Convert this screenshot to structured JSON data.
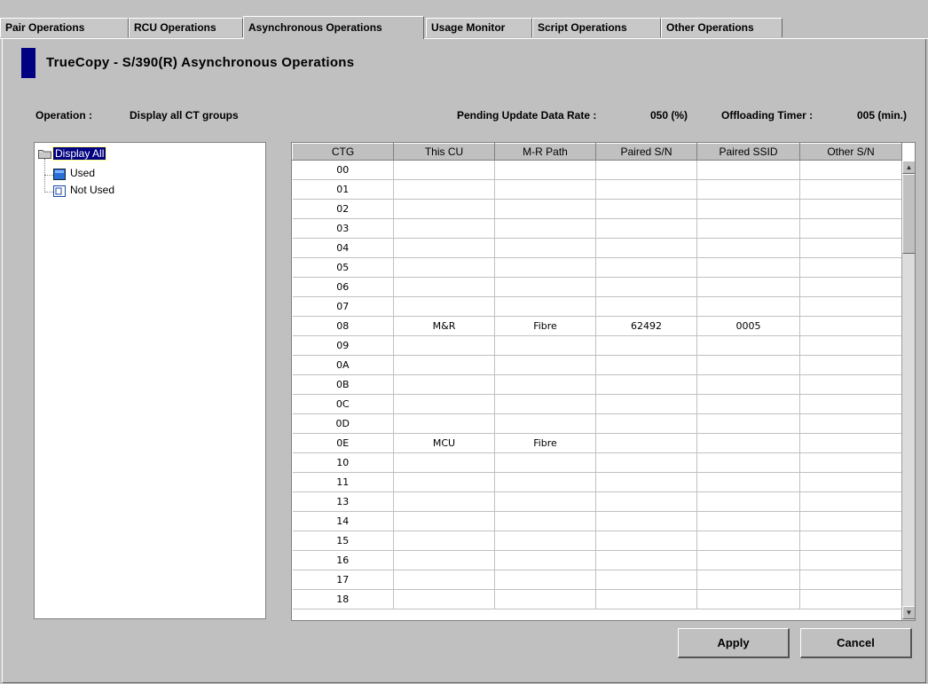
{
  "tabs": [
    {
      "label": "Pair Operations",
      "active": false
    },
    {
      "label": "RCU Operations",
      "active": false
    },
    {
      "label": "Asynchronous Operations",
      "active": true
    },
    {
      "label": "Usage Monitor",
      "active": false
    },
    {
      "label": "Script Operations",
      "active": false
    },
    {
      "label": "Other Operations",
      "active": false
    }
  ],
  "title": "TrueCopy - S/390(R) Asynchronous Operations",
  "operation": {
    "label": "Operation :",
    "value": "Display all CT groups"
  },
  "pending": {
    "label": "Pending Update Data Rate :",
    "value": "050 (%)"
  },
  "offloading": {
    "label": "Offloading Timer :",
    "value": "005 (min.)"
  },
  "tree": {
    "root": "Display All",
    "children": [
      "Used",
      "Not Used"
    ]
  },
  "table": {
    "columns": [
      "CTG",
      "This CU",
      "M-R Path",
      "Paired S/N",
      "Paired SSID",
      "Other S/N"
    ],
    "rows": [
      [
        "00",
        "",
        "",
        "",
        "",
        ""
      ],
      [
        "01",
        "",
        "",
        "",
        "",
        ""
      ],
      [
        "02",
        "",
        "",
        "",
        "",
        ""
      ],
      [
        "03",
        "",
        "",
        "",
        "",
        ""
      ],
      [
        "04",
        "",
        "",
        "",
        "",
        ""
      ],
      [
        "05",
        "",
        "",
        "",
        "",
        ""
      ],
      [
        "06",
        "",
        "",
        "",
        "",
        ""
      ],
      [
        "07",
        "",
        "",
        "",
        "",
        ""
      ],
      [
        "08",
        "M&R",
        "Fibre",
        "62492",
        "0005",
        ""
      ],
      [
        "09",
        "",
        "",
        "",
        "",
        ""
      ],
      [
        "0A",
        "",
        "",
        "",
        "",
        ""
      ],
      [
        "0B",
        "",
        "",
        "",
        "",
        ""
      ],
      [
        "0C",
        "",
        "",
        "",
        "",
        ""
      ],
      [
        "0D",
        "",
        "",
        "",
        "",
        ""
      ],
      [
        "0E",
        "MCU",
        "Fibre",
        "",
        "",
        ""
      ],
      [
        "10",
        "",
        "",
        "",
        "",
        ""
      ],
      [
        "11",
        "",
        "",
        "",
        "",
        ""
      ],
      [
        "13",
        "",
        "",
        "",
        "",
        ""
      ],
      [
        "14",
        "",
        "",
        "",
        "",
        ""
      ],
      [
        "15",
        "",
        "",
        "",
        "",
        ""
      ],
      [
        "16",
        "",
        "",
        "",
        "",
        ""
      ],
      [
        "17",
        "",
        "",
        "",
        "",
        ""
      ],
      [
        "18",
        "",
        "",
        "",
        "",
        ""
      ]
    ]
  },
  "buttons": {
    "apply": "Apply",
    "cancel": "Cancel"
  },
  "icons": {
    "scroll_up": "scroll-up-arrow-icon",
    "scroll_down": "scroll-down-arrow-icon"
  }
}
